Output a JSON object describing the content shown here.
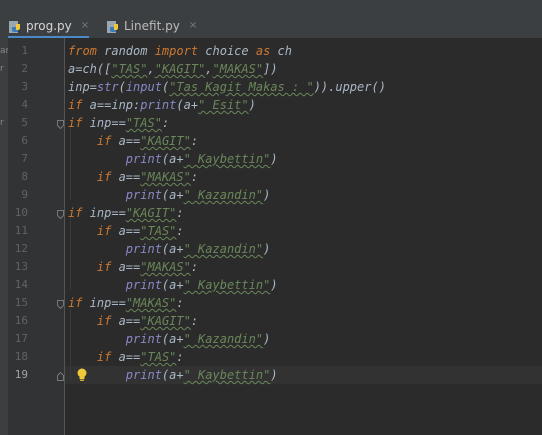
{
  "tabs": [
    {
      "label": "prog.py",
      "close": "×",
      "active": true
    },
    {
      "label": "Linefit.py",
      "close": "×",
      "active": false
    }
  ],
  "sidebar": {
    "letters": [
      "ar",
      "r",
      "r"
    ]
  },
  "editor": {
    "current_line": 19,
    "line_numbers": [
      "1",
      "2",
      "3",
      "4",
      "5",
      "6",
      "7",
      "8",
      "9",
      "10",
      "11",
      "12",
      "13",
      "14",
      "15",
      "16",
      "17",
      "18",
      "19"
    ],
    "lines": [
      "from random import choice as ch",
      "a=ch([\"TAS\",\"KAGIT\",\"MAKAS\"])",
      "inp=str(input(\"Tas Kagit Makas : \")).upper()",
      "if a==inp:print(a+\" Esit\")",
      "if inp==\"TAS\":",
      "    if a==\"KAGIT\":",
      "        print(a+\" Kaybettin\")",
      "    if a==\"MAKAS\":",
      "        print(a+\" Kazandin\")",
      "if inp==\"KAGIT\":",
      "    if a==\"TAS\":",
      "        print(a+\" Kazandin\")",
      "    if a==\"MAKAS\":",
      "        print(a+\" Kaybettin\")",
      "if inp==\"MAKAS\":",
      "    if a==\"KAGIT\":",
      "        print(a+\" Kazandin\")",
      "    if a==\"TAS\":",
      "        print(a+\" Kaybettin\")"
    ]
  },
  "colors": {
    "keyword": "#cc7832",
    "string": "#6a8759",
    "builtin": "#8888c6",
    "text": "#a9b7c6",
    "background": "#2b2b2b"
  },
  "icons": {
    "file": "python-file-icon",
    "hint": "lightbulb-icon"
  }
}
